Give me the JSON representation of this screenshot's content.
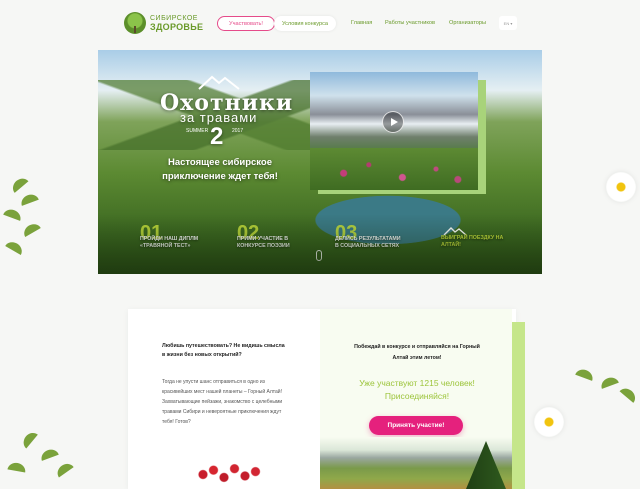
{
  "header": {
    "logo_line1": "СИБИРСКОЕ",
    "logo_line2": "ЗДОРОВЬЕ",
    "participate_button": "Участвовать!",
    "nav": {
      "contest_conditions": "Условия конкурса",
      "home": "Главная",
      "works": "Работы участников",
      "organizers": "Организаторы"
    },
    "lang": "EN ▾"
  },
  "hero": {
    "title": "Охотники",
    "title_sub": "за травами",
    "summer": "SUMMER",
    "number": "2",
    "year": "2017",
    "subtitle": "Настоящее сибирское приключение ждет тебя!",
    "steps": [
      {
        "num": "01",
        "text": "Пройди наш Диплм «Травяной тест»"
      },
      {
        "num": "02",
        "text": "Прими участие в конкурсе поэзии"
      },
      {
        "num": "03",
        "text": "Делись результатами в социальных сетях"
      }
    ],
    "trip_text": "Выиграй поездку на Алтай!"
  },
  "card": {
    "left_title": "Любишь путешествовать? Не видишь смысла в жизни без новых открытий?",
    "left_body": "Тогда не упусти шанс отправиться в одно из красивейших мест нашей планеты – Горный Алтай! Захватывающие пейзажи, знакомство с целебными травами Сибири и невероятные приключения ждут тебя! Готов?",
    "right_title": "Побеждай в конкурсе и отправляйся на Горный Алтай этим летом!",
    "count_text": "Уже участвуют 1215 человек! Присоединяйся!",
    "accept_button": "Принять участие!"
  },
  "colors": {
    "accent_pink": "#e5217d",
    "brand_green": "#6a9a2a",
    "lime": "#c6e03c"
  }
}
